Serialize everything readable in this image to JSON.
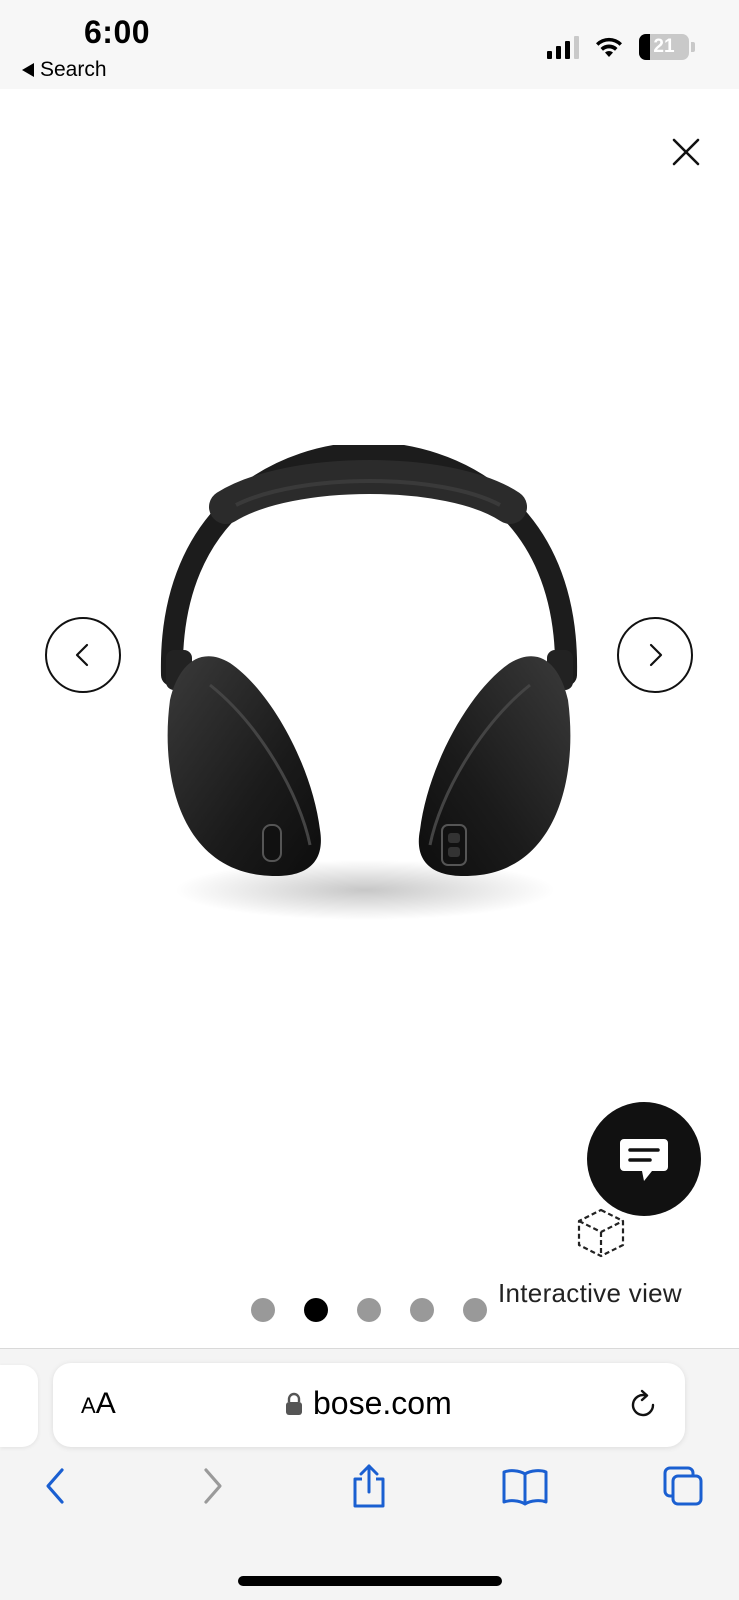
{
  "status_bar": {
    "time": "6:00",
    "back_app_label": "Search",
    "battery_level": "21",
    "battery_fraction": 0.21,
    "signal_bars_filled": 3,
    "signal_bars_total": 4
  },
  "viewer": {
    "close_icon": "close-icon",
    "prev_icon": "chevron-left-icon",
    "next_icon": "chevron-right-icon",
    "image_description": "headphones-product-image",
    "chat_icon": "chat-bubble-icon",
    "interactive_view_icon": "3d-cube-icon",
    "interactive_view_label": "Interactive view",
    "carousel": {
      "total": 5,
      "active_index": 1
    }
  },
  "browser": {
    "text_size_small": "A",
    "text_size_large": "A",
    "url": "bose.com",
    "lock_icon": "lock-icon",
    "reload_icon": "reload-icon",
    "toolbar_icons": [
      "back-icon",
      "forward-icon",
      "share-icon",
      "bookmarks-icon",
      "tabs-icon"
    ]
  },
  "colors": {
    "accent": "#1a5fd1",
    "dot_inactive": "#999999",
    "dot_active": "#000000",
    "chat_button": "#111111"
  }
}
